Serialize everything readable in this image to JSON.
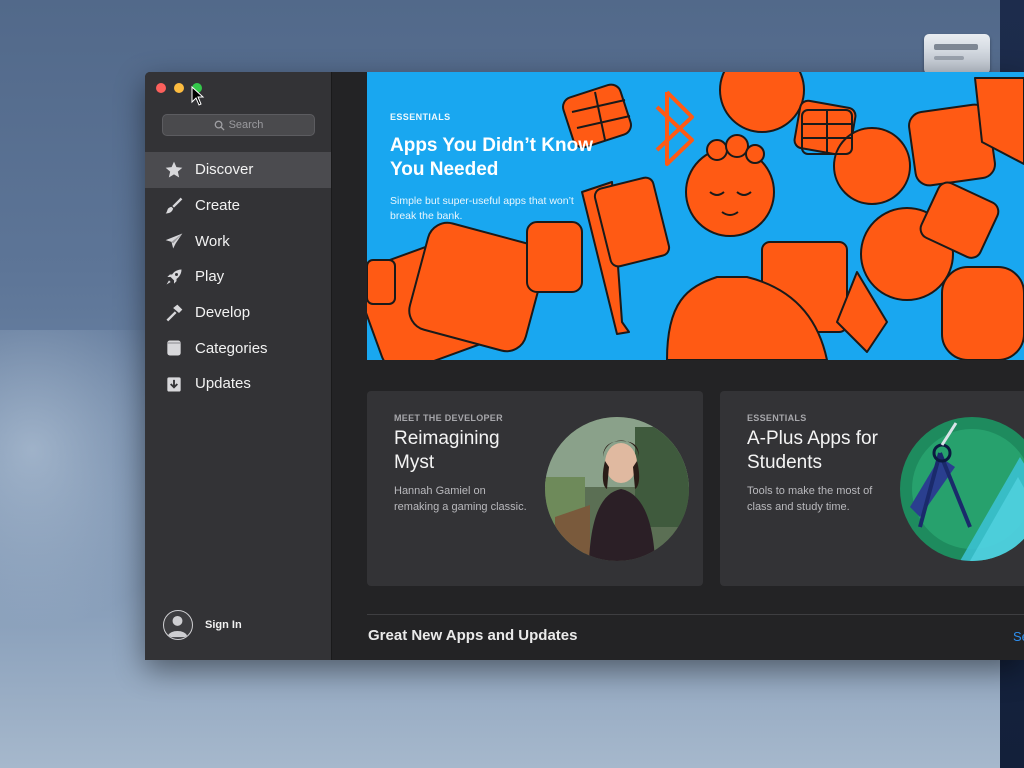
{
  "search": {
    "placeholder": "Search"
  },
  "sidebar": {
    "items": [
      {
        "label": "Discover",
        "icon": "star-icon"
      },
      {
        "label": "Create",
        "icon": "brush-icon"
      },
      {
        "label": "Work",
        "icon": "paper-plane-icon"
      },
      {
        "label": "Play",
        "icon": "rocket-icon"
      },
      {
        "label": "Develop",
        "icon": "hammer-icon"
      },
      {
        "label": "Categories",
        "icon": "categories-icon"
      },
      {
        "label": "Updates",
        "icon": "download-icon"
      }
    ],
    "active": "Discover",
    "signin": "Sign In"
  },
  "hero": {
    "eyebrow": "ESSENTIALS",
    "title": "Apps You Didn’t Know You Needed",
    "subtitle": "Simple but super-useful apps that won’t break the bank.",
    "colors": {
      "background": "#19a7f0",
      "accent": "#ff5a14"
    }
  },
  "cards": [
    {
      "eyebrow": "MEET THE DEVELOPER",
      "title": "Reimagining Myst",
      "subtitle": "Hannah Gamiel on remaking a gaming classic."
    },
    {
      "eyebrow": "ESSENTIALS",
      "title": "A-Plus Apps for Students",
      "subtitle": "Tools to make the most of class and study time."
    }
  ],
  "section": {
    "title": "Great New Apps and Updates",
    "see_all": "Se"
  },
  "colors": {
    "sidebar": "#333336",
    "content": "#232325",
    "link": "#2e8ff0"
  }
}
